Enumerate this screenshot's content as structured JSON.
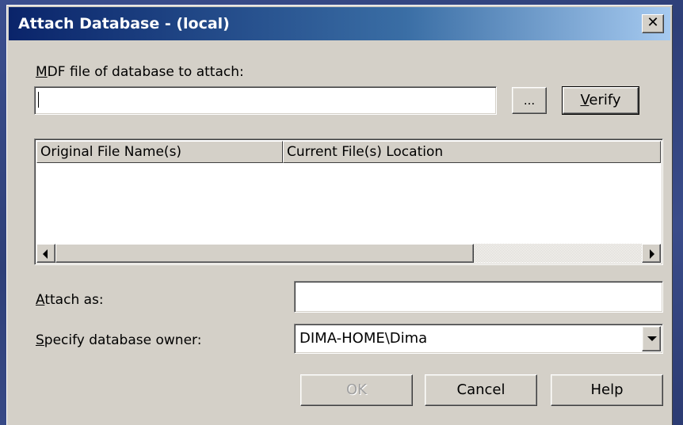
{
  "window": {
    "title": "Attach Database - (local)",
    "close_glyph": "✕"
  },
  "mdf": {
    "label_prefix": "",
    "label_accel": "M",
    "label_rest": "DF file of database to attach:",
    "value": "",
    "browse_label": "...",
    "verify_accel": "V",
    "verify_rest": "erify"
  },
  "files_table": {
    "columns": [
      "Original File Name(s)",
      "Current File(s) Location"
    ],
    "rows": []
  },
  "attach_as": {
    "label_accel": "A",
    "label_rest": "ttach as:",
    "value": ""
  },
  "owner": {
    "label_accel": "S",
    "label_rest": "pecify database owner:",
    "selected": "DIMA-HOME\\Dima"
  },
  "buttons": {
    "ok": "OK",
    "cancel": "Cancel",
    "help": "Help"
  },
  "icons": {
    "close": "close-icon",
    "scroll_left": "arrow-left-icon",
    "scroll_right": "arrow-right-icon",
    "dropdown": "chevron-down-icon"
  },
  "colors": {
    "title_start": "#0a246a",
    "title_end": "#a6caf0",
    "dialog_face": "#d4d0c8"
  }
}
